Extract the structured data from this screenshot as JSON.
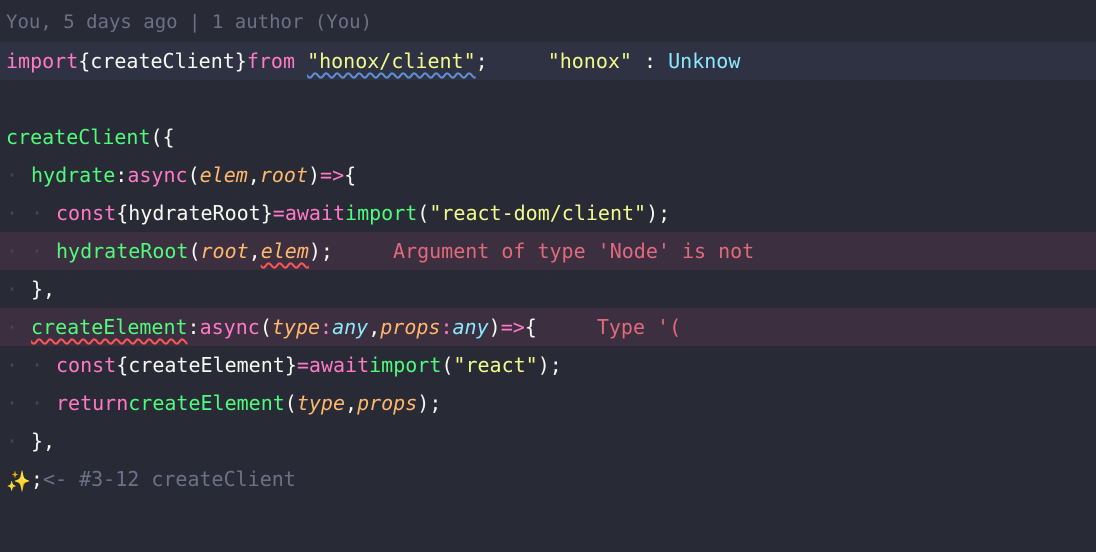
{
  "blame": "You, 5 days ago | 1 author (You)",
  "colors": {
    "bg": "#282a36",
    "keyword": "#ff79c6",
    "function": "#50fa7b",
    "string": "#f1fa8c",
    "param": "#ffb86c",
    "type": "#8be9fd",
    "error": "#e06a7c",
    "hint": "#6d7186"
  },
  "code": {
    "l1": {
      "import": "import",
      "brace_open": " { ",
      "sym": "createClient",
      "brace_close": " } ",
      "from": "from",
      "str": "\"honox/client\"",
      "semi": ";",
      "diag_label": "\"honox\"",
      "diag_sep": ":  ",
      "diag_msg": "Unknow"
    },
    "l3": {
      "fn": "createClient",
      "open": "({"
    },
    "l4": {
      "prop": "hydrate",
      "colon": ": ",
      "async": "async ",
      "open": "(",
      "p1": "elem",
      "comma": ", ",
      "p2": "root",
      "close": ") ",
      "arrow": "=>",
      "brace": " {"
    },
    "l5": {
      "const": "const",
      "brace_open": " { ",
      "sym": "hydrateRoot",
      "brace_close": " } ",
      "eq": "= ",
      "await": "await",
      "sp": " ",
      "import": "import",
      "open": "(",
      "str": "\"react-dom/client\"",
      "close": ");"
    },
    "l6": {
      "fn": "hydrateRoot",
      "open": "(",
      "p1": "root",
      "comma": ", ",
      "p2": "elem",
      "close": ");",
      "err": "Argument of type 'Node' is not"
    },
    "l7": {
      "close": "},"
    },
    "l8": {
      "prop": "createElement",
      "colon": ": ",
      "async": "async ",
      "open": "(",
      "p1": "type",
      "t1sep": ": ",
      "t1": "any",
      "comma": ", ",
      "p2": "props",
      "t2sep": ": ",
      "t2": "any",
      "close": ") ",
      "arrow": "=>",
      "brace": " {",
      "err": "Type '("
    },
    "l9": {
      "const": "const",
      "brace_open": " { ",
      "sym": "createElement",
      "brace_close": " } ",
      "eq": "= ",
      "await": "await",
      "sp": " ",
      "import": "import",
      "open": "(",
      "str": "\"react\"",
      "close": ");"
    },
    "l10": {
      "return": "return",
      "sp": " ",
      "fn": "createElement",
      "open": "(",
      "p1": "type",
      "comma": ", ",
      "p2": "props",
      "close": ");"
    },
    "l11": {
      "close": "},"
    },
    "l12": {
      "sparkle": "✨",
      "close": ";",
      "hint": " <- #3-12 createClient"
    }
  }
}
